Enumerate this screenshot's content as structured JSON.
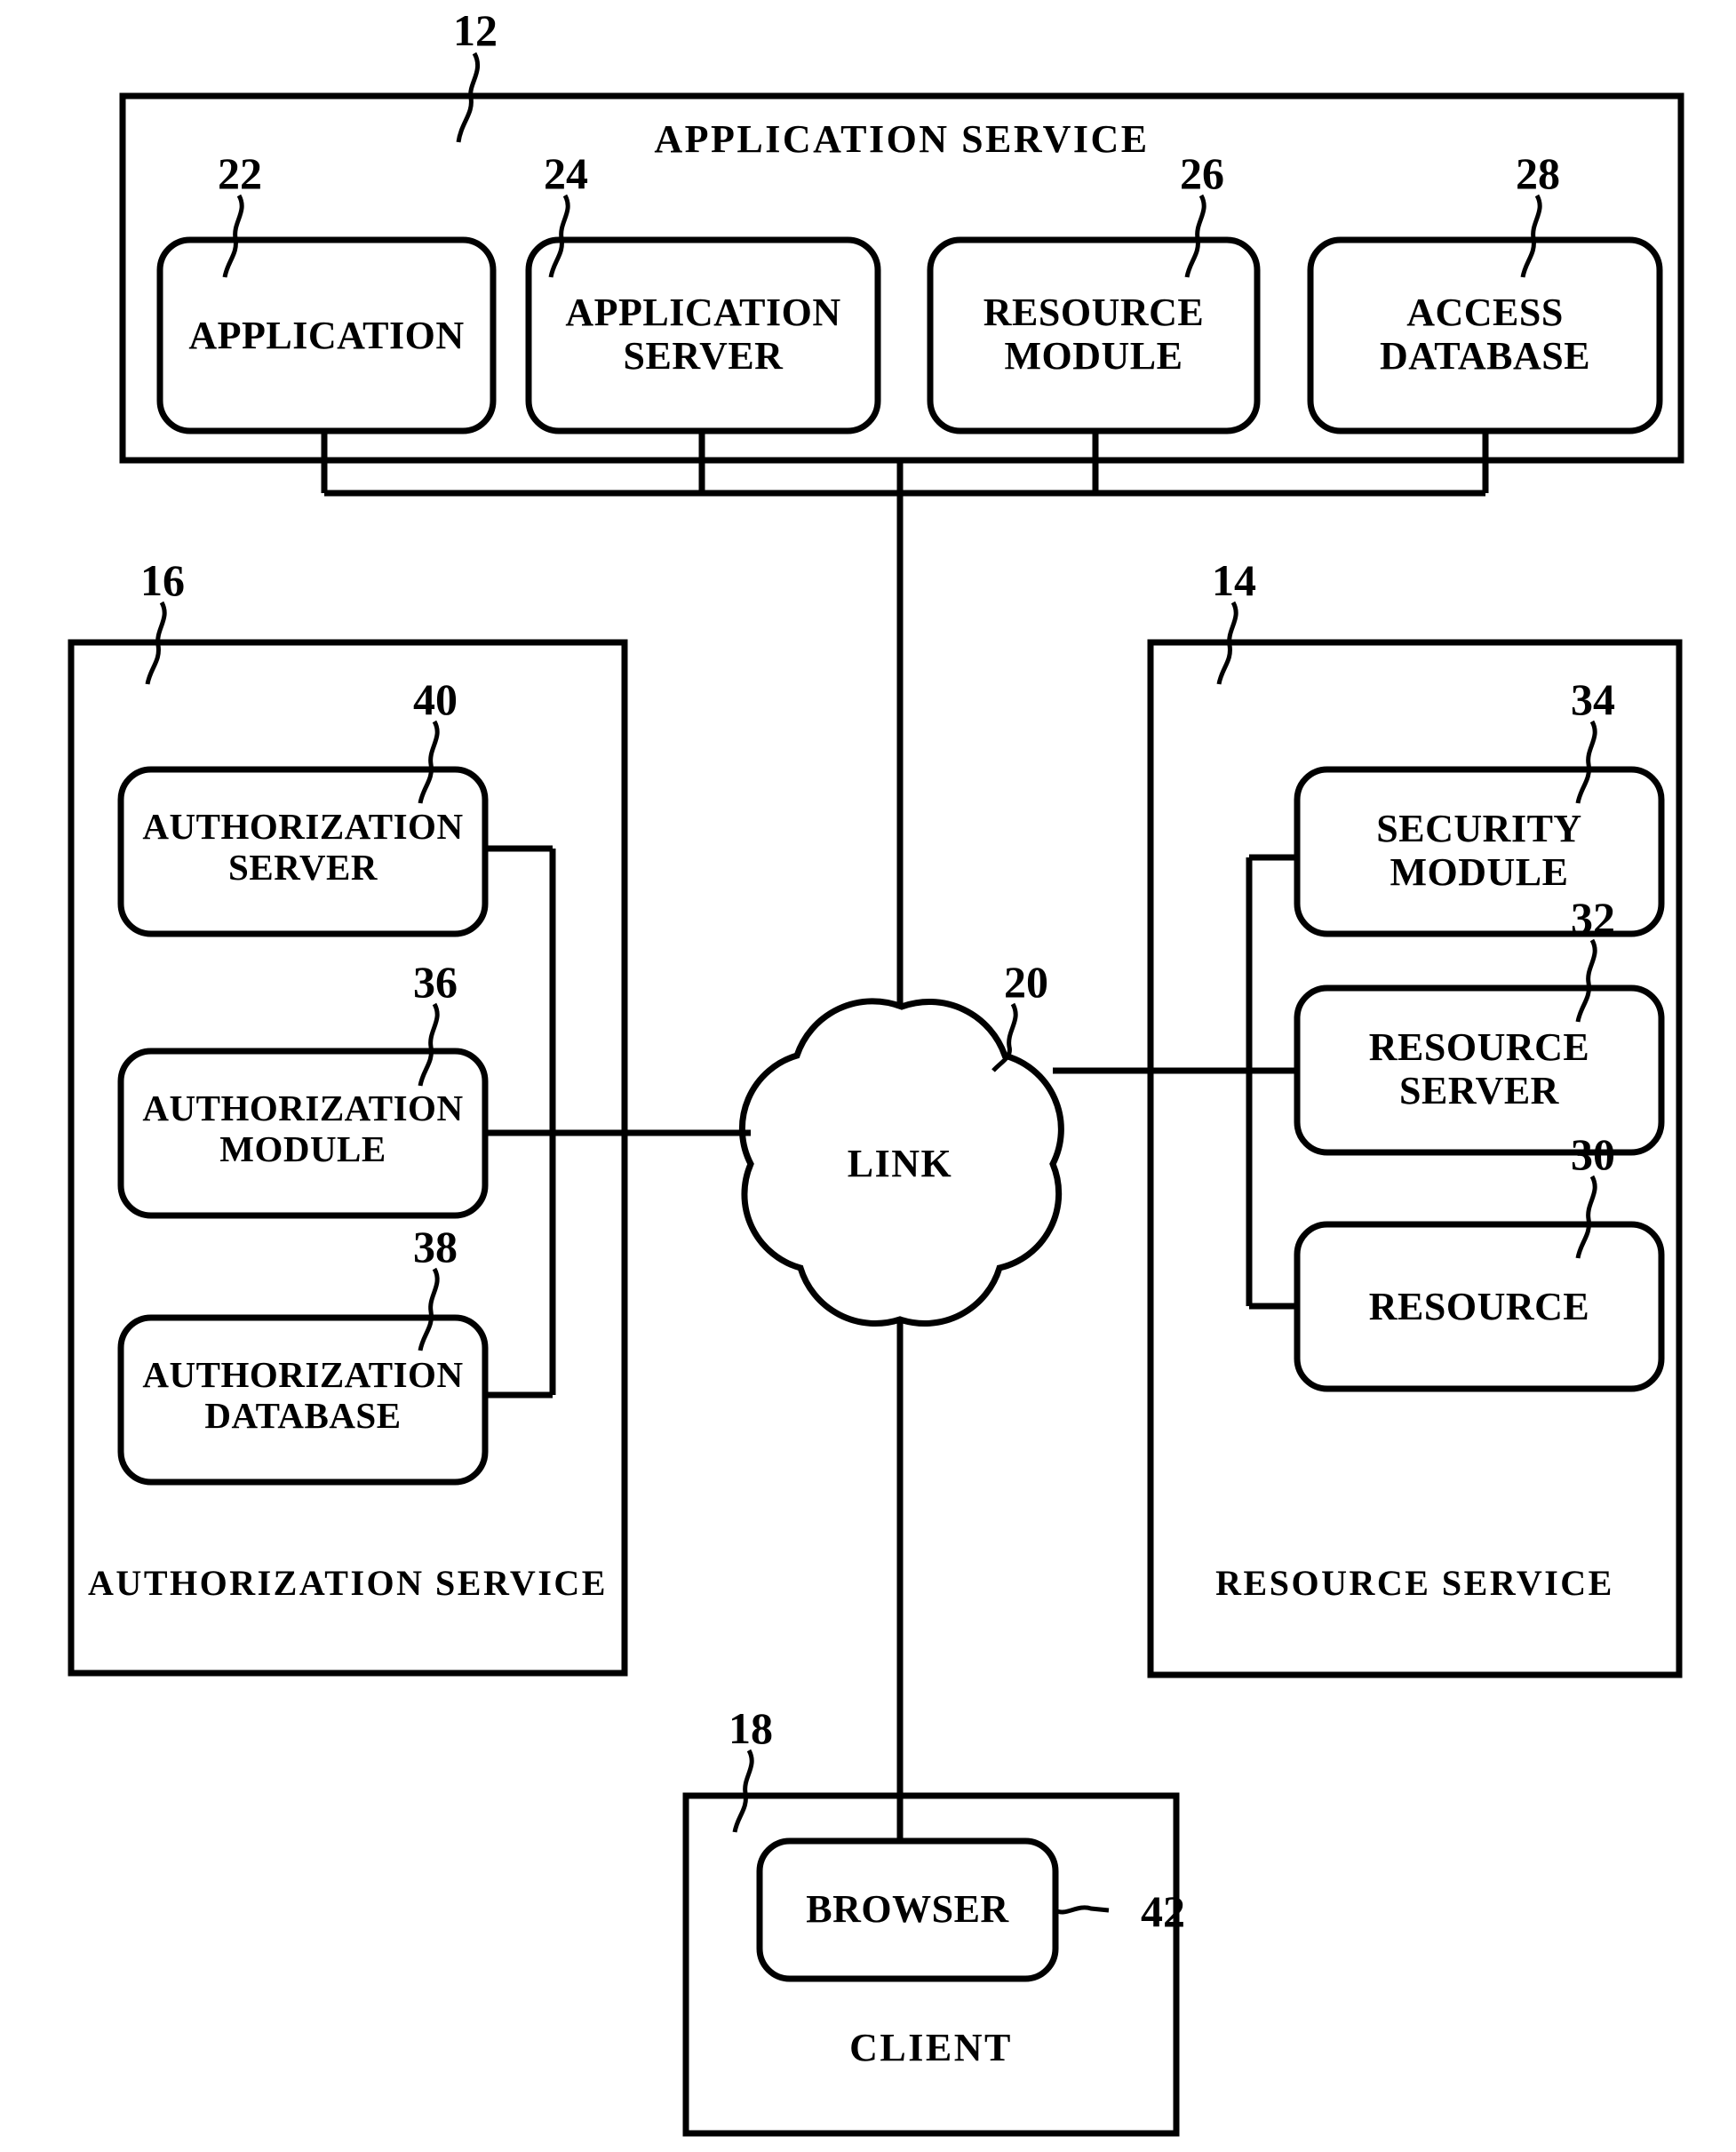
{
  "figure": {
    "title": "System architecture block diagram",
    "background_color": "#ffffff",
    "line_color": "#000000"
  },
  "containers": {
    "application_service": {
      "label": "APPLICATION  SERVICE",
      "ref": "12",
      "ref_label": "12"
    },
    "authorization_service": {
      "label": "AUTHORIZATION  SERVICE",
      "ref": "16",
      "ref_label": "16"
    },
    "resource_service": {
      "label": "RESOURCE  SERVICE",
      "ref": "14",
      "ref_label": "14"
    },
    "client": {
      "label": "CLIENT",
      "ref": "18",
      "ref_label": "18"
    }
  },
  "blocks": {
    "application": {
      "label": "APPLICATION",
      "ref": "22"
    },
    "application_server": {
      "label": "APPLICATION\nSERVER",
      "ref": "24"
    },
    "resource_module": {
      "label": "RESOURCE\nMODULE",
      "ref": "26"
    },
    "access_database": {
      "label": "ACCESS\nDATABASE",
      "ref": "28"
    },
    "authorization_server": {
      "label": "AUTHORIZATION\nSERVER",
      "ref": "40"
    },
    "authorization_module": {
      "label": "AUTHORIZATION\nMODULE",
      "ref": "36"
    },
    "authorization_database": {
      "label": "AUTHORIZATION\nDATABASE",
      "ref": "38"
    },
    "security_module": {
      "label": "SECURITY\nMODULE",
      "ref": "34"
    },
    "resource_server": {
      "label": "RESOURCE\nSERVER",
      "ref": "32"
    },
    "resource": {
      "label": "RESOURCE",
      "ref": "30"
    },
    "browser": {
      "label": "BROWSER",
      "ref": "42"
    }
  },
  "network": {
    "link_cloud": {
      "label": "LINK",
      "ref": "20"
    }
  }
}
